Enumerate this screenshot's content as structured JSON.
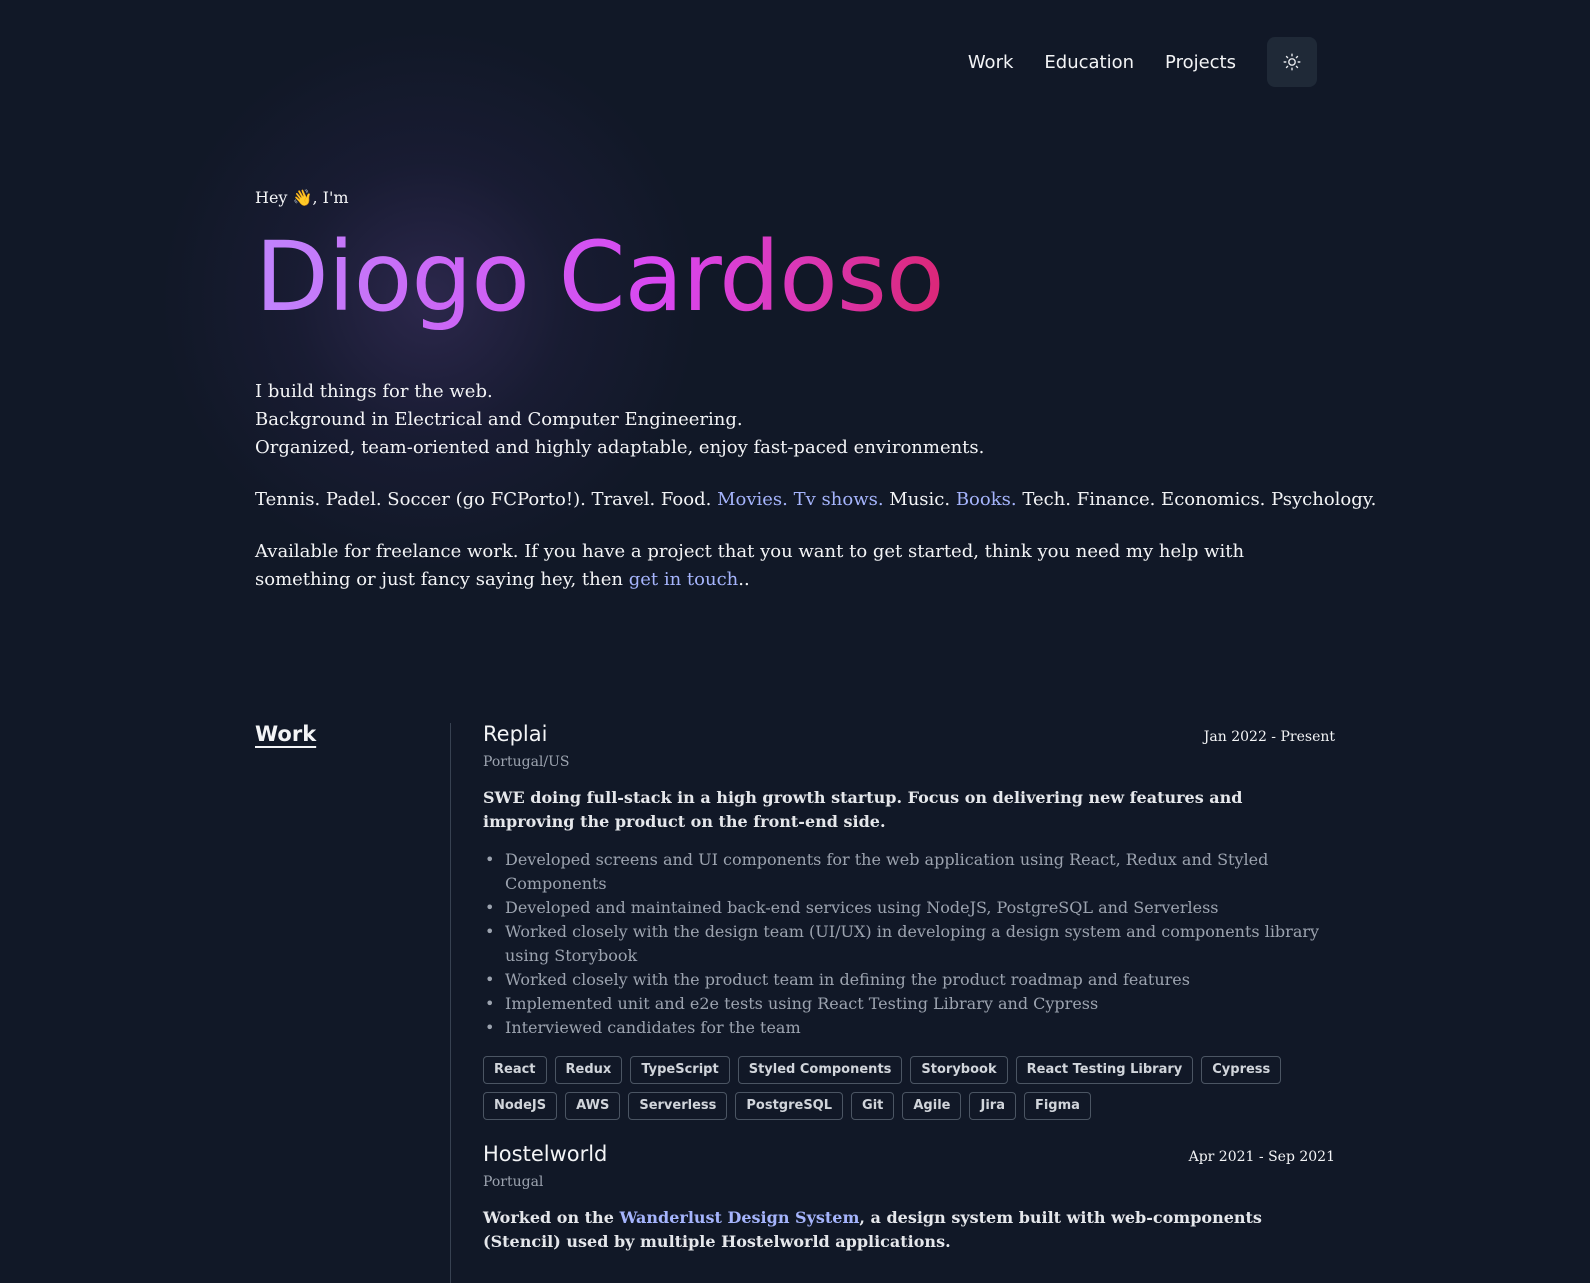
{
  "nav": {
    "items": [
      "Work",
      "Education",
      "Projects"
    ],
    "theme_toggle_icon": "sun-icon"
  },
  "hero": {
    "greeting": "Hey 👋, I'm",
    "name": "Diogo Cardoso",
    "bio_lines": [
      "I build things for the web.",
      "Background in Electrical and Computer Engineering.",
      "Organized, team-oriented and highly adaptable, enjoy fast-paced environments."
    ],
    "hobbies": {
      "part1": "Tennis. Padel. Soccer (go FCPorto!). Travel. Food. ",
      "movies_link": "Movies.",
      "tv_link": "Tv shows.",
      "part2": " Music. ",
      "books_link": "Books.",
      "part3": " Tech. Finance. Economics. Psychology."
    },
    "availability": {
      "text": "Available for freelance work. If you have a project that you want to get started, think you need my help with something or just fancy saying hey, then ",
      "link": "get in touch",
      "suffix": ".."
    }
  },
  "work": {
    "heading": "Work",
    "jobs": [
      {
        "company": "Replai",
        "dates": "Jan 2022 - Present",
        "location": "Portugal/US",
        "summary": "SWE doing full-stack in a high growth startup. Focus on delivering new features and improving the product on the front-end side.",
        "bullets": [
          "Developed screens and UI components for the web application using React, Redux and Styled Components",
          "Developed and maintained back-end services using NodeJS, PostgreSQL and Serverless",
          "Worked closely with the design team (UI/UX) in developing a design system and components library using Storybook",
          "Worked closely with the product team in defining the product roadmap and features",
          "Implemented unit and e2e tests using React Testing Library and Cypress",
          "Interviewed candidates for the team"
        ],
        "tags": [
          "React",
          "Redux",
          "TypeScript",
          "Styled Components",
          "Storybook",
          "React Testing Library",
          "Cypress",
          "NodeJS",
          "AWS",
          "Serverless",
          "PostgreSQL",
          "Git",
          "Agile",
          "Jira",
          "Figma"
        ]
      },
      {
        "company": "Hostelworld",
        "dates": "Apr 2021 - Sep 2021",
        "location": "Portugal",
        "summary_prefix": "Worked on the ",
        "summary_link": "Wanderlust Design System",
        "summary_suffix": ", a design system built with web-components (Stencil) used by multiple Hostelworld applications."
      }
    ]
  },
  "colors": {
    "background": "#111827",
    "accent_link": "#a5b4fc",
    "name_gradient_start": "#c084fc",
    "name_gradient_end": "#db2777"
  }
}
